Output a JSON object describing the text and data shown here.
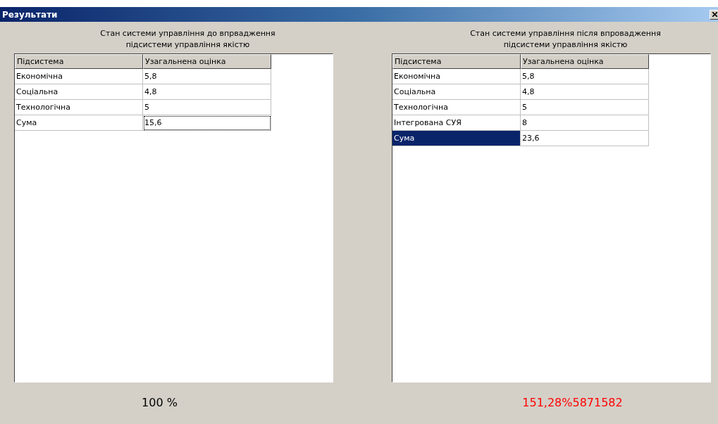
{
  "window": {
    "title": "Результати"
  },
  "panels": [
    {
      "caption": "Стан системи управління до впрвадження\nпідсистеми управління якістю",
      "columns": [
        "Підсистема",
        "Узагальнена оцінка"
      ],
      "rows": [
        {
          "cells": [
            {
              "text": "Економічна",
              "selected": false,
              "focused": false
            },
            {
              "text": "5,8",
              "selected": false,
              "focused": false
            }
          ]
        },
        {
          "cells": [
            {
              "text": "Соціальна",
              "selected": false,
              "focused": false
            },
            {
              "text": "4,8",
              "selected": false,
              "focused": false
            }
          ]
        },
        {
          "cells": [
            {
              "text": "Технологічна",
              "selected": false,
              "focused": false
            },
            {
              "text": "5",
              "selected": false,
              "focused": false
            }
          ]
        },
        {
          "cells": [
            {
              "text": "Сума",
              "selected": false,
              "focused": false
            },
            {
              "text": "15,6",
              "selected": false,
              "focused": true
            }
          ]
        }
      ],
      "result": {
        "text": "100 %",
        "color": "#000000"
      }
    },
    {
      "caption": "Стан системи управління після впровадження\nпідсистеми управління якістю",
      "columns": [
        "Підсистема",
        "Узагальнена оцінка"
      ],
      "rows": [
        {
          "cells": [
            {
              "text": "Економічна",
              "selected": false,
              "focused": false
            },
            {
              "text": "5,8",
              "selected": false,
              "focused": false
            }
          ]
        },
        {
          "cells": [
            {
              "text": "Соціальна",
              "selected": false,
              "focused": false
            },
            {
              "text": "4,8",
              "selected": false,
              "focused": false
            }
          ]
        },
        {
          "cells": [
            {
              "text": "Технологічна",
              "selected": false,
              "focused": false
            },
            {
              "text": "5",
              "selected": false,
              "focused": false
            }
          ]
        },
        {
          "cells": [
            {
              "text": "Інтегрована СУЯ",
              "selected": false,
              "focused": false
            },
            {
              "text": "8",
              "selected": false,
              "focused": false
            }
          ]
        },
        {
          "cells": [
            {
              "text": "Сума",
              "selected": true,
              "focused": false
            },
            {
              "text": "23,6",
              "selected": false,
              "focused": false
            }
          ]
        }
      ],
      "result": {
        "text": "151,28%5871582",
        "color": "#ff0000"
      }
    }
  ]
}
